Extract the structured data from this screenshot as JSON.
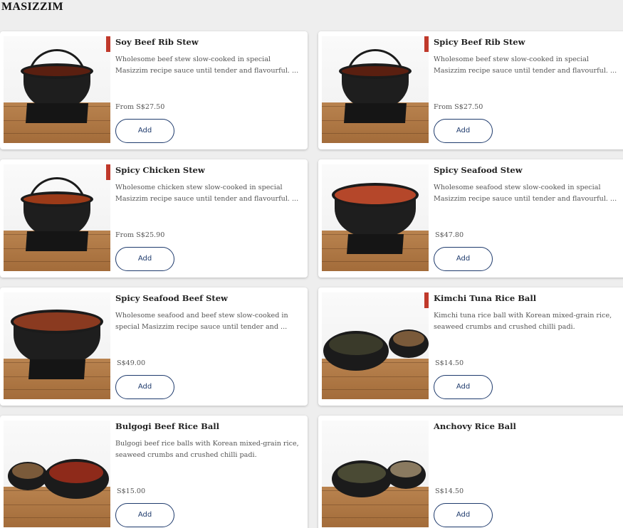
{
  "section": {
    "title": "MASIZZIM"
  },
  "items": [
    {
      "name": "Soy Beef Rib Stew",
      "desc_line1": "Wholesome beef stew slow-cooked in special",
      "desc_line2": "Masizzim recipe sauce until tender and flavourful. ...",
      "price": "From S$27.50",
      "add_label": "Add",
      "flagged": true,
      "image": "beef-rib-stew-pot"
    },
    {
      "name": "Spicy Beef Rib Stew",
      "desc_line1": "Wholesome beef stew slow-cooked in special",
      "desc_line2": "Masizzim recipe sauce until tender and flavourful. ...",
      "price": "From S$27.50",
      "add_label": "Add",
      "flagged": true,
      "image": "beef-rib-stew-pot"
    },
    {
      "name": "Spicy Chicken Stew",
      "desc_line1": "Wholesome chicken stew slow-cooked in special",
      "desc_line2": "Masizzim recipe sauce until tender and flavourful. ...",
      "price": "From S$25.90",
      "add_label": "Add",
      "flagged": true,
      "image": "chicken-stew-pot"
    },
    {
      "name": "Spicy Seafood Stew",
      "desc_line1": "Wholesome seafood stew slow-cooked in special",
      "desc_line2": "Masizzim recipe sauce until tender and flavourful. ...",
      "price": "S$47.80",
      "add_label": "Add",
      "flagged": false,
      "image": "seafood-stew-pot"
    },
    {
      "name": "Spicy Seafood Beef Stew",
      "desc_line1": "Wholesome seafood and beef stew slow-cooked in",
      "desc_line2": "special Masizzim recipe sauce until tender and ...",
      "price": "S$49.00",
      "add_label": "Add",
      "flagged": false,
      "image": "seafood-beef-stew-pot"
    },
    {
      "name": "Kimchi Tuna Rice Ball",
      "desc_line1": "Kimchi tuna rice ball with Korean mixed-grain rice,",
      "desc_line2": "seaweed crumbs and crushed chilli padi.",
      "price": "S$14.50",
      "add_label": "Add",
      "flagged": true,
      "image": "rice-ball-bowls"
    },
    {
      "name": "Bulgogi Beef Rice Ball",
      "desc_line1": "Bulgogi beef rice balls with Korean mixed-grain rice,",
      "desc_line2": "seaweed crumbs and crushed chilli padi.",
      "price": "S$15.00",
      "add_label": "Add",
      "flagged": false,
      "image": "rice-ball-bowls"
    },
    {
      "name": "Anchovy Rice Ball",
      "desc_line1": "",
      "desc_line2": "",
      "price": "S$14.50",
      "add_label": "Add",
      "flagged": false,
      "image": "rice-ball-bowls"
    }
  ],
  "colors": {
    "accent": "#1f3b6d",
    "flag": "#c0392b",
    "background": "#eeeeee"
  }
}
